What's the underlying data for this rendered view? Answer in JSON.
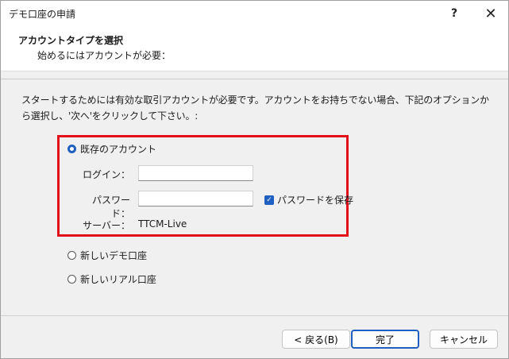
{
  "window": {
    "title": "デモ口座の申請",
    "help_label": "?",
    "close_label": "✕"
  },
  "header": {
    "title": "アカウントタイプを選択",
    "subtitle": "始めるにはアカウントが必要："
  },
  "description": "スタートするためには有効な取引アカウントが必要です。アカウントをお持ちでない場合、下記のオプションから選択し、'次へ'をクリックして下さい。:",
  "options": {
    "existing": {
      "label": "既存のアカウント",
      "selected": true
    },
    "new_demo": {
      "label": "新しいデモ口座",
      "selected": false
    },
    "new_real": {
      "label": "新しいリアル口座",
      "selected": false
    }
  },
  "form": {
    "login_label": "ログイン：",
    "login_value": "",
    "password_label": "パスワード：",
    "password_value": "",
    "save_password_label": "パスワードを保存",
    "save_password_checked": true,
    "server_label": "サーバー：",
    "server_value": "TTCM-Live"
  },
  "buttons": {
    "back": "< 戻る(B)",
    "finish": "完了",
    "cancel": "キャンセル"
  },
  "colors": {
    "accent": "#1f5fbf",
    "highlight_border": "#e3101a"
  },
  "icons": {
    "checkmark": "✓"
  }
}
